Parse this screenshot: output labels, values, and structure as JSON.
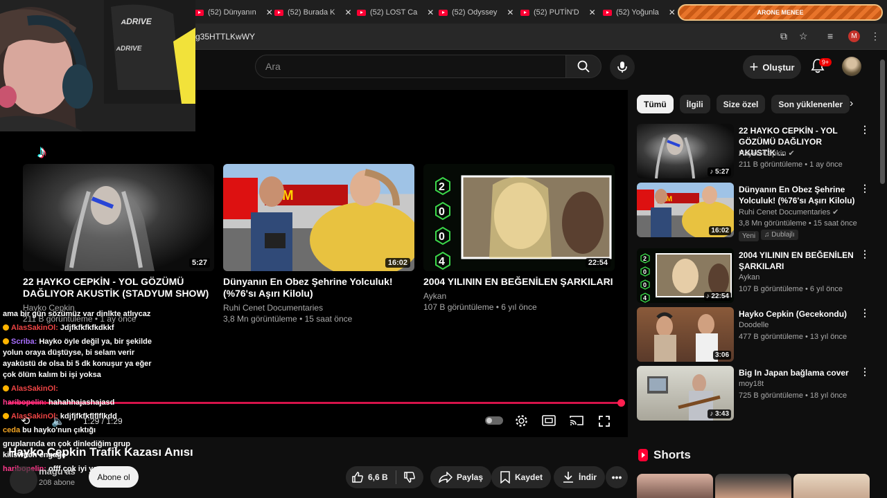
{
  "browser": {
    "tabs": [
      {
        "label": "(52) Dünyanın"
      },
      {
        "label": "(52) Burada K"
      },
      {
        "label": "(52) LOST Ca"
      },
      {
        "label": "(52) Odyssey"
      },
      {
        "label": "(52) PUTİN'D"
      },
      {
        "label": "(52) Yoğunla"
      }
    ],
    "active_tab_label": "ARONE MENEE",
    "url": "g35HTTLKwWY",
    "profile_initial": "M"
  },
  "header": {
    "search_placeholder": "Ara",
    "create_label": "Oluştur",
    "notifications": "9+"
  },
  "player": {
    "time": "1:29 / 1:29",
    "end_cards": [
      {
        "title": "22 HAYKO CEPKİN - YOL GÖZÜMÜ DAĞLIYOR AKUSTİK (STADYUM SHOW)",
        "channel": "Hayko Cepkin",
        "meta": "211 B görüntüleme • 1 ay önce",
        "duration": "5:27"
      },
      {
        "title": "Dünyanın En Obez Şehrine Yolculuk! (%76'sı Aşırı Kilolu)",
        "channel": "Ruhi Cenet Documentaries",
        "meta": "3,8 Mn görüntüleme • 15 saat önce",
        "duration": "16:02"
      },
      {
        "title": "2004 YILININ EN BEĞENİLEN ŞARKILARI",
        "channel": "Aykan",
        "meta": "107 B görüntüleme • 6 yıl önce",
        "duration": "22:54"
      }
    ]
  },
  "chat": [
    {
      "user": "",
      "text": "ama bir gün sözümüz var dinlkte atlıycaz",
      "color": ""
    },
    {
      "user": "AlasSakinOl:",
      "text": "Jdjfkfkfkfkdkkf",
      "color": "red"
    },
    {
      "user": "Scriba:",
      "text": "Hayko öyle değil ya, bir şekilde yolun oraya düştüyse, bi selam verir ayaküstü de olsa bi 5 dk konuşur ya eğer çok ölüm kalım bi işi yoksa",
      "color": "purple"
    },
    {
      "user": "AlasSakinOl:",
      "text": "",
      "color": "red"
    },
    {
      "user": "haribopelin:",
      "text": "hahahhajashajasd",
      "color": "pink"
    },
    {
      "user": "AlasSakinOl:",
      "text": "kdjfjfkfkflflflkdd",
      "color": "red"
    },
    {
      "user": "ceda",
      "text": "bu hayko'nun çıktığı",
      "color": "orange"
    },
    {
      "user": "",
      "text": "gruplarında en çok dinlediğim grup killswitch engage",
      "color": ""
    },
    {
      "user": "haribopelin:",
      "text": "offf çok iyi ya",
      "color": "pink"
    }
  ],
  "video": {
    "title": "Hayko Cepkin Trafik Kazası Anısı",
    "channel": "magu as",
    "subs": "208 abone",
    "subscribe_label": "Abone ol",
    "likes": "6,6 B",
    "share_label": "Paylaş",
    "save_label": "Kaydet",
    "download_label": "İndir"
  },
  "sidebar": {
    "chips": [
      "Tümü",
      "İlgili",
      "Size özel",
      "Son yüklenenler"
    ],
    "recommendations": [
      {
        "title": "22 HAYKO CEPKİN - YOL GÖZÜMÜ DAĞLIYOR AKUSTİK ...",
        "channel": "Hayko Cepkin",
        "meta": "211 B görüntüleme • 1 ay önce",
        "duration": "5:27",
        "badges": []
      },
      {
        "title": "Dünyanın En Obez Şehrine Yolculuk! (%76'sı Aşırı Kilolu)",
        "channel": "Ruhi Cenet Documentaries",
        "meta": "3,8 Mn görüntüleme • 15 saat önce",
        "duration": "16:02",
        "badges": [
          "Yeni",
          "Dublajlı"
        ]
      },
      {
        "title": "2004 YILININ EN BEĞENİLEN ŞARKILARI",
        "channel": "Aykan",
        "meta": "107 B görüntüleme • 6 yıl önce",
        "duration": "22:54",
        "badges": []
      },
      {
        "title": "Hayko Cepkin (Gecekondu)",
        "channel": "Doodelle",
        "meta": "477 B görüntüleme • 13 yıl önce",
        "duration": "3:06",
        "badges": []
      },
      {
        "title": "Big In Japan bağlama cover",
        "channel": "moy18t",
        "meta": "725 B görüntüleme • 18 yıl önce",
        "duration": "3:43",
        "badges": []
      }
    ],
    "shorts_label": "Shorts"
  }
}
